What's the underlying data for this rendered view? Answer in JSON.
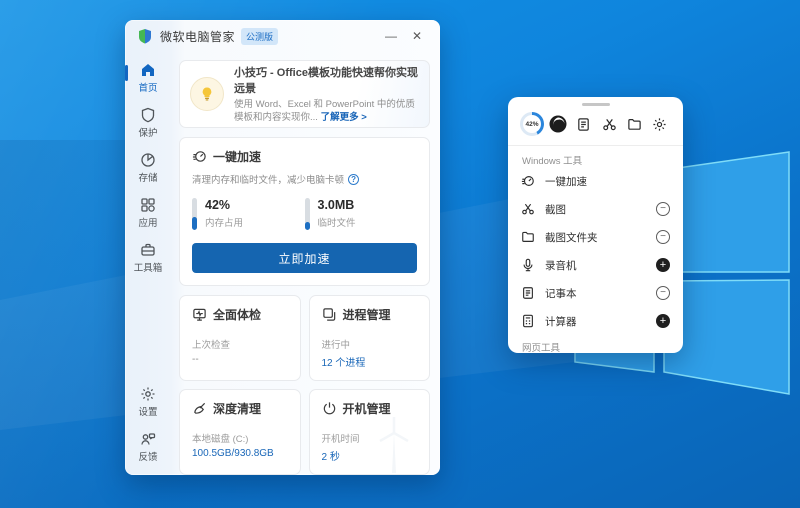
{
  "desktop": {
    "wallpaper_base_color": "#0d7fd9",
    "logo_pane_color": "#2f9fe8",
    "logo_edge_color": "#8ae0fa"
  },
  "window": {
    "titlebar": {
      "title": "微软电脑管家",
      "badge": "公测版",
      "minimize_glyph": "—",
      "close_glyph": "✕"
    },
    "sidebar": {
      "items": [
        {
          "label": "首页"
        },
        {
          "label": "保护"
        },
        {
          "label": "存储"
        },
        {
          "label": "应用"
        },
        {
          "label": "工具箱"
        }
      ],
      "bottom_items": [
        {
          "label": "设置"
        },
        {
          "label": "反馈"
        }
      ]
    },
    "banner": {
      "title": "小技巧 - Office模板功能快速帮你实现远景",
      "desc": "使用 Word、Excel 和 PowerPoint 中的优质模板和内容实现你...",
      "link": "了解更多 >"
    },
    "boost_card": {
      "title": "一键加速",
      "desc": "清理内存和临时文件，减少电脑卡顿",
      "info_glyph": "?",
      "stats": [
        {
          "value": "42%",
          "label": "内存占用"
        },
        {
          "value": "3.0MB",
          "label": "临时文件"
        }
      ],
      "button": "立即加速"
    },
    "cards": [
      {
        "title": "全面体检",
        "caption": "上次检查",
        "value": "--"
      },
      {
        "title": "进程管理",
        "caption": "进行中",
        "value": "12 个进程"
      },
      {
        "title": "深度清理",
        "caption": "本地磁盘 (C:)",
        "value": "100.5GB/930.8GB"
      },
      {
        "title": "开机管理",
        "caption": "开机时间",
        "value": "2 秒"
      }
    ]
  },
  "flyout": {
    "memory_percent": "42%",
    "section_label": "Windows 工具",
    "items": [
      {
        "label": "一键加速"
      },
      {
        "label": "截图"
      },
      {
        "label": "截图文件夹"
      },
      {
        "label": "录音机"
      },
      {
        "label": "记事本"
      },
      {
        "label": "计算器"
      }
    ],
    "glyphs": {
      "minus": "−",
      "plus": "+"
    },
    "clipped_section_label": "网页工具"
  },
  "styles": {
    "mem_fill_height": "42%",
    "temp_fill_height": "24%",
    "ring_background": "conic-gradient(#2b86dc 0% 42%, #dde9f5 42% 100%)"
  }
}
